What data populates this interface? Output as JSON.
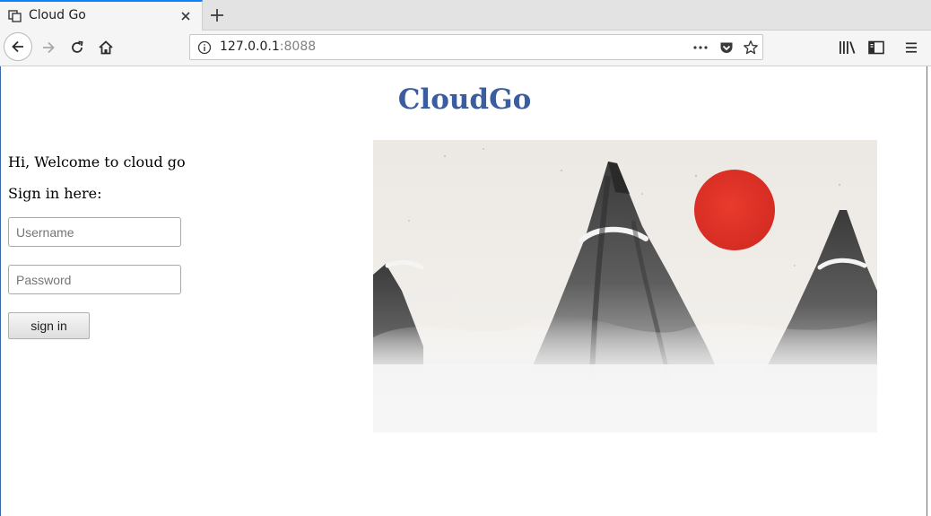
{
  "browser": {
    "tab": {
      "title": "Cloud Go",
      "favicon_icon": "generic-page-icon"
    },
    "url": {
      "host": "127.0.0.1",
      "port": ":8088"
    },
    "icons": {
      "back": "back-arrow-icon",
      "forward": "forward-arrow-icon",
      "reload": "reload-icon",
      "home": "home-icon",
      "info": "info-icon",
      "more": "ellipsis-icon",
      "pocket": "pocket-icon",
      "bookmark": "star-icon",
      "library": "library-icon",
      "sidebar": "sidebar-icon",
      "menu": "hamburger-menu-icon"
    }
  },
  "page": {
    "title": "CloudGo",
    "welcome": "Hi, Welcome to cloud go",
    "signin_heading": "Sign in here:",
    "username_placeholder": "Username",
    "password_placeholder": "Password",
    "signin_label": "sign in"
  },
  "colors": {
    "title": "#3b5c9e",
    "sun": "#e0342a",
    "tab_accent": "#0a84ff"
  }
}
